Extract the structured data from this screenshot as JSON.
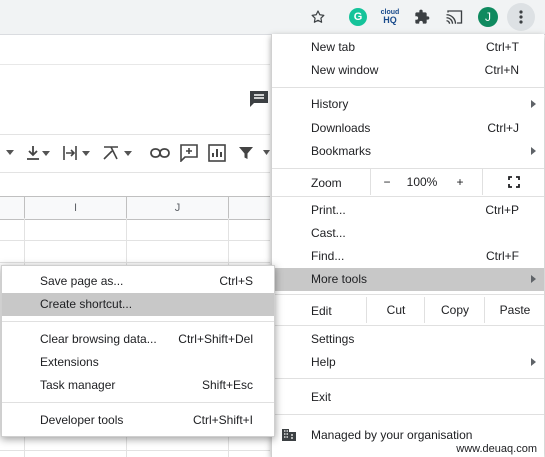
{
  "toolbar": {
    "avatar_letter": "J",
    "grammarly_letter": "G",
    "ext_text_line1": "cloud",
    "ext_text_line2": "HQ"
  },
  "sheet": {
    "columns": [
      "I",
      "J"
    ]
  },
  "menu": {
    "new_tab": {
      "label": "New tab",
      "shortcut": "Ctrl+T"
    },
    "new_window": {
      "label": "New window",
      "shortcut": "Ctrl+N"
    },
    "history": {
      "label": "History"
    },
    "downloads": {
      "label": "Downloads",
      "shortcut": "Ctrl+J"
    },
    "bookmarks": {
      "label": "Bookmarks"
    },
    "zoom": {
      "label": "Zoom",
      "minus": "−",
      "value": "100%",
      "plus": "+"
    },
    "print": {
      "label": "Print...",
      "shortcut": "Ctrl+P"
    },
    "cast": {
      "label": "Cast..."
    },
    "find": {
      "label": "Find...",
      "shortcut": "Ctrl+F"
    },
    "more_tools": {
      "label": "More tools"
    },
    "edit": {
      "label": "Edit",
      "cut": "Cut",
      "copy": "Copy",
      "paste": "Paste"
    },
    "settings": {
      "label": "Settings"
    },
    "help": {
      "label": "Help"
    },
    "exit": {
      "label": "Exit"
    },
    "managed": {
      "label": "Managed by your organisation"
    }
  },
  "submenu": {
    "save_page": {
      "label": "Save page as...",
      "shortcut": "Ctrl+S"
    },
    "create_shortcut": {
      "label": "Create shortcut..."
    },
    "clear_browsing": {
      "label": "Clear browsing data...",
      "shortcut": "Ctrl+Shift+Del"
    },
    "extensions": {
      "label": "Extensions"
    },
    "task_manager": {
      "label": "Task manager",
      "shortcut": "Shift+Esc"
    },
    "developer_tools": {
      "label": "Developer tools",
      "shortcut": "Ctrl+Shift+I"
    }
  },
  "watermark": "www.deuaq.com"
}
